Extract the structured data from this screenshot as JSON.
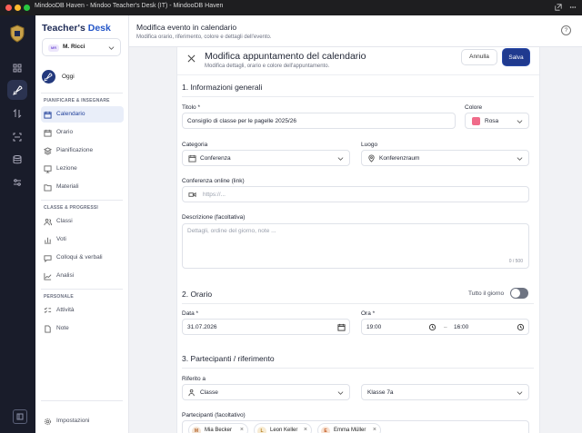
{
  "titlebar": {
    "title": "MindooDB Haven - Mindoo Teacher's Desk (IT) - MindooDB Haven",
    "dots": [
      "#ff5f57",
      "#febc2e",
      "#28c840"
    ]
  },
  "rail": {
    "icons": [
      "dashboard-icon",
      "rocket-icon",
      "transfer-icon",
      "scan-icon",
      "database-icon",
      "settings-sliders-icon"
    ],
    "active_index": 1
  },
  "sidebar": {
    "brand_main": "Teacher's ",
    "brand_accent": "Desk",
    "user_initials": "MR",
    "user_name": "M. Ricci",
    "today": "Oggi",
    "section_planning": "PIANIFICARE & INSEGNARE",
    "planning_items": [
      {
        "label": "Calendario",
        "icon": "calendar-icon",
        "active": true
      },
      {
        "label": "Orario",
        "icon": "clock-icon"
      },
      {
        "label": "Pianificazione",
        "icon": "layers-icon"
      },
      {
        "label": "Lezione",
        "icon": "presentation-icon"
      },
      {
        "label": "Materiali",
        "icon": "folder-icon"
      }
    ],
    "section_classes": "CLASSE & PROGRESSI",
    "classes_items": [
      {
        "label": "Classi",
        "icon": "users-icon"
      },
      {
        "label": "Voti",
        "icon": "chart-bars-icon"
      },
      {
        "label": "Colloqui & verbali",
        "icon": "chat-icon"
      },
      {
        "label": "Analisi",
        "icon": "trend-icon"
      }
    ],
    "section_personal": "PERSONALE",
    "personal_items": [
      {
        "label": "Attività",
        "icon": "checklist-icon"
      },
      {
        "label": "Note",
        "icon": "note-icon"
      }
    ],
    "settings": "Impostazioni"
  },
  "header": {
    "title": "Modifica evento in calendario",
    "subtitle": "Modifica orario, riferimento, colore e dettagli dell'evento."
  },
  "modal": {
    "title": "Modifica appuntamento del calendario",
    "subtitle": "Modifica dettagli, orario e colore dell'appuntamento.",
    "cancel": "Annulla",
    "save": "Salva",
    "section1": "1. Informazioni generali",
    "title_label": "Titolo *",
    "title_value": "Consiglio di classe per le pagelle 2025/26",
    "color_label": "Colore",
    "color_value": "Rosa",
    "color_hex": "#f06b8a",
    "category_label": "Categoria",
    "category_value": "Conferenza",
    "location_label": "Luogo",
    "location_value": "Konferenzraum",
    "online_label": "Conferenza online (link)",
    "online_placeholder": "https://...",
    "desc_label": "Descrizione (facoltativa)",
    "desc_placeholder": "Dettagli, ordine del giorno, note ...",
    "desc_counter": "0 / 500",
    "section2": "2. Orario",
    "allday_label": "Tutto il giorno",
    "allday_on": false,
    "date_label": "Data *",
    "date_value": "31.07.2026",
    "time_label": "Ora *",
    "time_start": "19:00",
    "time_sep": "–",
    "time_end": "16:00",
    "section3": "3. Partecipanti / riferimento",
    "ref_label": "Riferito a",
    "ref_type": "Classe",
    "ref_value": "Klasse 7a",
    "participants_label": "Partecipanti (facoltativo)",
    "participants": [
      {
        "initial": "M",
        "name": "Mia Becker",
        "color": "#f3e3d4",
        "text": "#b5652a"
      },
      {
        "initial": "L",
        "name": "Leon Keller",
        "color": "#f7ebd2",
        "text": "#b07a1a"
      },
      {
        "initial": "E",
        "name": "Emma Müller",
        "color": "#f8e2d2",
        "text": "#c0551c"
      }
    ]
  }
}
